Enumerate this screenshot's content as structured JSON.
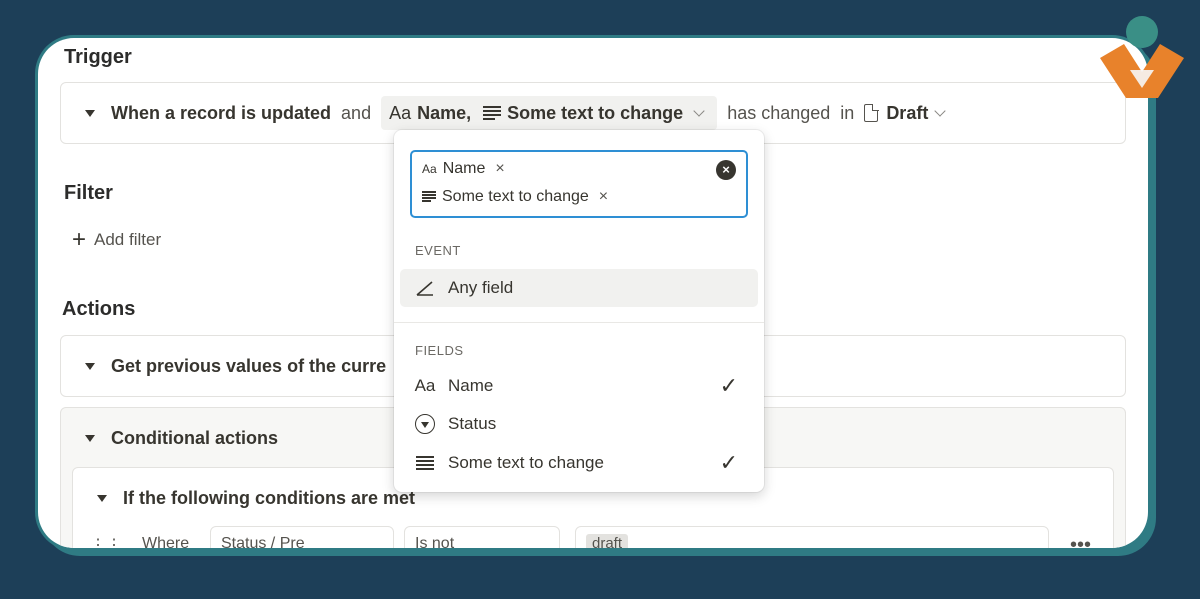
{
  "trigger": {
    "title": "Trigger",
    "when": "When a record is updated",
    "and": "and",
    "field_aa": "Aa",
    "field_name": "Name,",
    "field_text": "Some text to change",
    "has_changed": "has changed",
    "in": "in",
    "db": "Draft"
  },
  "filter": {
    "title": "Filter",
    "add_label": "Add filter"
  },
  "actions": {
    "title": "Actions",
    "item1": "Get previous values of the curre",
    "item2": "Conditional actions",
    "sub": "If the following conditions are met",
    "where": "Where",
    "cond_field": "Status / Pre",
    "cond_op": "Is not",
    "cond_value": "draft"
  },
  "dropdown": {
    "tags": [
      {
        "icon": "Aa",
        "label": "Name"
      },
      {
        "icon": "lines-icon",
        "label": "Some text to change"
      }
    ],
    "remove_symbol": "×",
    "clear_symbol": "×",
    "event_label": "EVENT",
    "event_item": "Any field",
    "fields_label": "FIELDS",
    "fields": [
      {
        "icon": "Aa",
        "label": "Name",
        "checked": true
      },
      {
        "icon": "status-icon",
        "label": "Status",
        "checked": false
      },
      {
        "icon": "lines-icon",
        "label": "Some text to change",
        "checked": true
      }
    ],
    "check_symbol": "✓"
  },
  "colors": {
    "background": "#1d3f58",
    "focus": "#2e8fd4",
    "logo_orange": "#e8822b",
    "logo_teal": "#3a8f86"
  }
}
